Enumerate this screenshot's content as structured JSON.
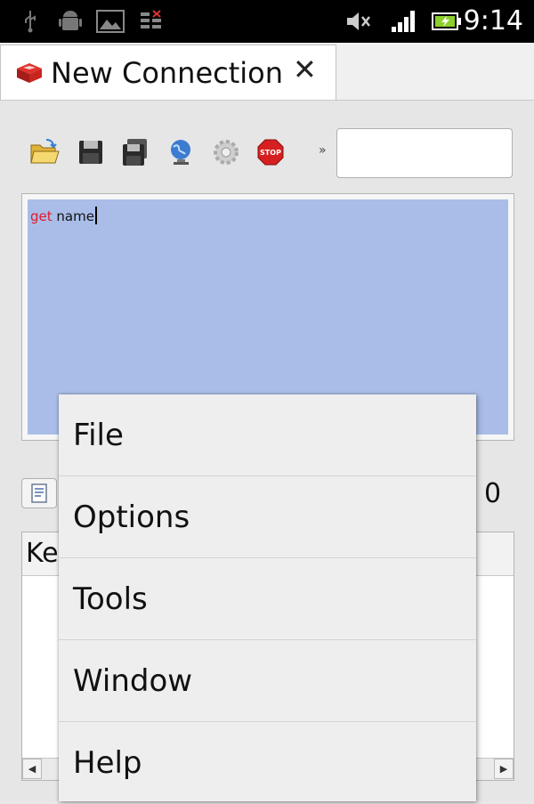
{
  "status_bar": {
    "time": "9:14",
    "icons": [
      "usb-icon",
      "android-debug-icon",
      "image-notification-icon",
      "data-sync-icon",
      "mute-icon",
      "signal-icon",
      "battery-charging-icon"
    ]
  },
  "tab": {
    "title": "New Connection",
    "close_glyph": "✕",
    "icon": "redis-icon"
  },
  "toolbar": {
    "buttons": [
      "open-folder-icon",
      "save-icon",
      "save-all-icon",
      "connect-icon",
      "settings-icon",
      "stop-icon"
    ],
    "stop_text": "STOP",
    "arrow_glyph": "»",
    "quick_input_value": ""
  },
  "editor": {
    "keyword": "get",
    "argument": " name",
    "background": "#a9bde8",
    "keyword_color": "#e2192c"
  },
  "results": {
    "count": "0",
    "column_header": "Ke",
    "scroll_left": "◀",
    "scroll_right": "▶"
  },
  "menu": {
    "items": [
      {
        "label": "File"
      },
      {
        "label": "Options"
      },
      {
        "label": "Tools"
      },
      {
        "label": "Window"
      },
      {
        "label": "Help"
      }
    ]
  }
}
